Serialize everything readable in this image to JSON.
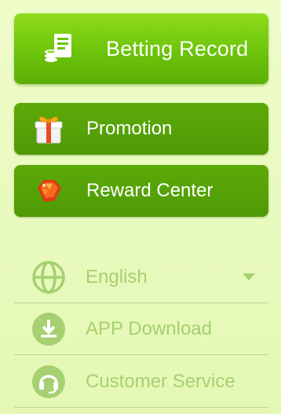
{
  "buttons": {
    "betting_record": "Betting Record",
    "promotion": "Promotion",
    "reward_center": "Reward Center"
  },
  "menu": {
    "language": {
      "label": "English",
      "icon": "globe-icon"
    },
    "app_download": {
      "label": "APP Download",
      "icon": "download-icon"
    },
    "customer_service": {
      "label": "Customer Service",
      "icon": "headset-icon"
    }
  },
  "colors": {
    "primary_green": "#6cc40a",
    "dark_green": "#4f9a06",
    "muted_green": "#a6d071",
    "background": "#eefcc8"
  }
}
